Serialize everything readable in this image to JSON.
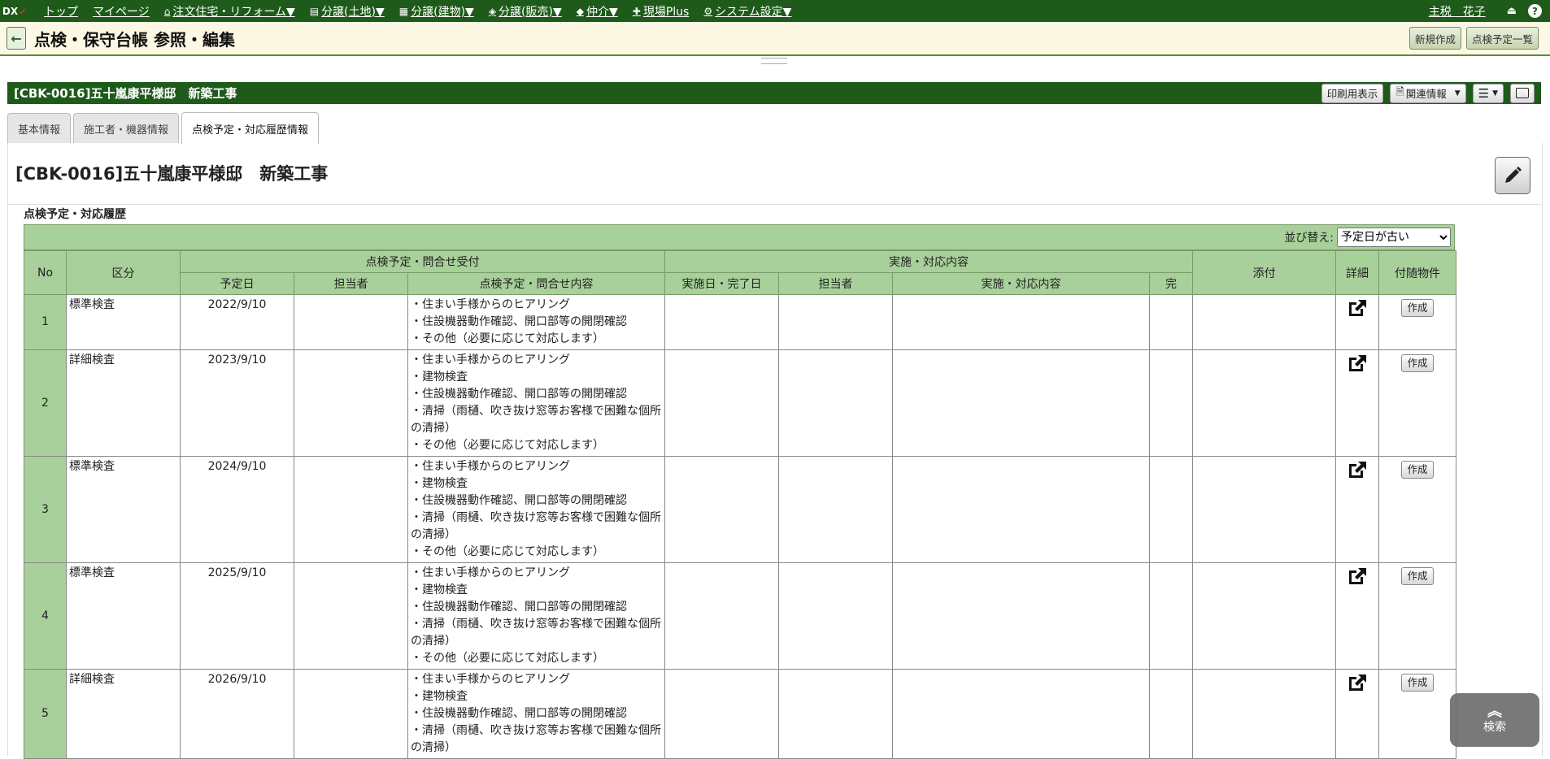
{
  "nav": {
    "logo_dx": "DX",
    "items": [
      {
        "label": "トップ",
        "icon": ""
      },
      {
        "label": "マイページ",
        "icon": ""
      },
      {
        "label": "注文住宅・リフォーム▼",
        "icon": "house-icon"
      },
      {
        "label": "分譲(土地)▼",
        "icon": "land-icon"
      },
      {
        "label": "分譲(建物)▼",
        "icon": "building-icon"
      },
      {
        "label": "分譲(販売)▼",
        "icon": "sale-icon"
      },
      {
        "label": "仲介▼",
        "icon": "broker-icon"
      },
      {
        "label": "現場Plus",
        "icon": "site-plus-icon"
      },
      {
        "label": "システム設定▼",
        "icon": "gear-icon"
      }
    ],
    "user": "主税　花子",
    "help": "?"
  },
  "titlebar": {
    "title": "点検・保守台帳 参照・編集",
    "new_label": "新規作成",
    "list_label": "点検予定一覧"
  },
  "record": {
    "title": "[CBK-0016]五十嵐康平様邸　新築工事",
    "print_label": "印刷用表示",
    "related_label": "関連情報"
  },
  "tabs": [
    {
      "label": "基本情報",
      "active": false
    },
    {
      "label": "施工者・機器情報",
      "active": false
    },
    {
      "label": "点検予定・対応履歴情報",
      "active": true
    }
  ],
  "section_title": "点検予定・対応履歴",
  "sort": {
    "label": "並び替え:",
    "selected": "予定日が古い"
  },
  "table": {
    "headers": {
      "no": "No",
      "kubun": "区分",
      "group_plan": "点検予定・問合せ受付",
      "group_exec": "実施・対応内容",
      "plan_date": "予定日",
      "plan_person": "担当者",
      "plan_content": "点検予定・問合せ内容",
      "exec_date": "実施日・完了日",
      "exec_person": "担当者",
      "exec_content": "実施・対応内容",
      "done": "完",
      "attach": "添付",
      "detail": "詳細",
      "property": "付随物件"
    },
    "create_label": "作成",
    "rows": [
      {
        "no": "1",
        "kubun": "標準検査",
        "date": "2022/9/10",
        "content": [
          "・住まい手様からのヒアリング",
          "・住設機器動作確認、開口部等の開閉確認",
          "・その他（必要に応じて対応します）"
        ]
      },
      {
        "no": "2",
        "kubun": "詳細検査",
        "date": "2023/9/10",
        "content": [
          "・住まい手様からのヒアリング",
          "・建物検査",
          "・住設機器動作確認、開口部等の開閉確認",
          "・清掃（雨樋、吹き抜け窓等お客様で困難な個所の清掃）",
          "・その他（必要に応じて対応します）"
        ]
      },
      {
        "no": "3",
        "kubun": "標準検査",
        "date": "2024/9/10",
        "content": [
          "・住まい手様からのヒアリング",
          "・建物検査",
          "・住設機器動作確認、開口部等の開閉確認",
          "・清掃（雨樋、吹き抜け窓等お客様で困難な個所の清掃）",
          "・その他（必要に応じて対応します）"
        ]
      },
      {
        "no": "4",
        "kubun": "標準検査",
        "date": "2025/9/10",
        "content": [
          "・住まい手様からのヒアリング",
          "・建物検査",
          "・住設機器動作確認、開口部等の開閉確認",
          "・清掃（雨樋、吹き抜け窓等お客様で困難な個所の清掃）",
          "・その他（必要に応じて対応します）"
        ]
      },
      {
        "no": "5",
        "kubun": "詳細検査",
        "date": "2026/9/10",
        "content": [
          "・住まい手様からのヒアリング",
          "・建物検査",
          "・住設機器動作確認、開口部等の開閉確認",
          "・清掃（雨樋、吹き抜け窓等お客様で困難な個所の清掃）"
        ]
      }
    ]
  },
  "search_label": "検索"
}
